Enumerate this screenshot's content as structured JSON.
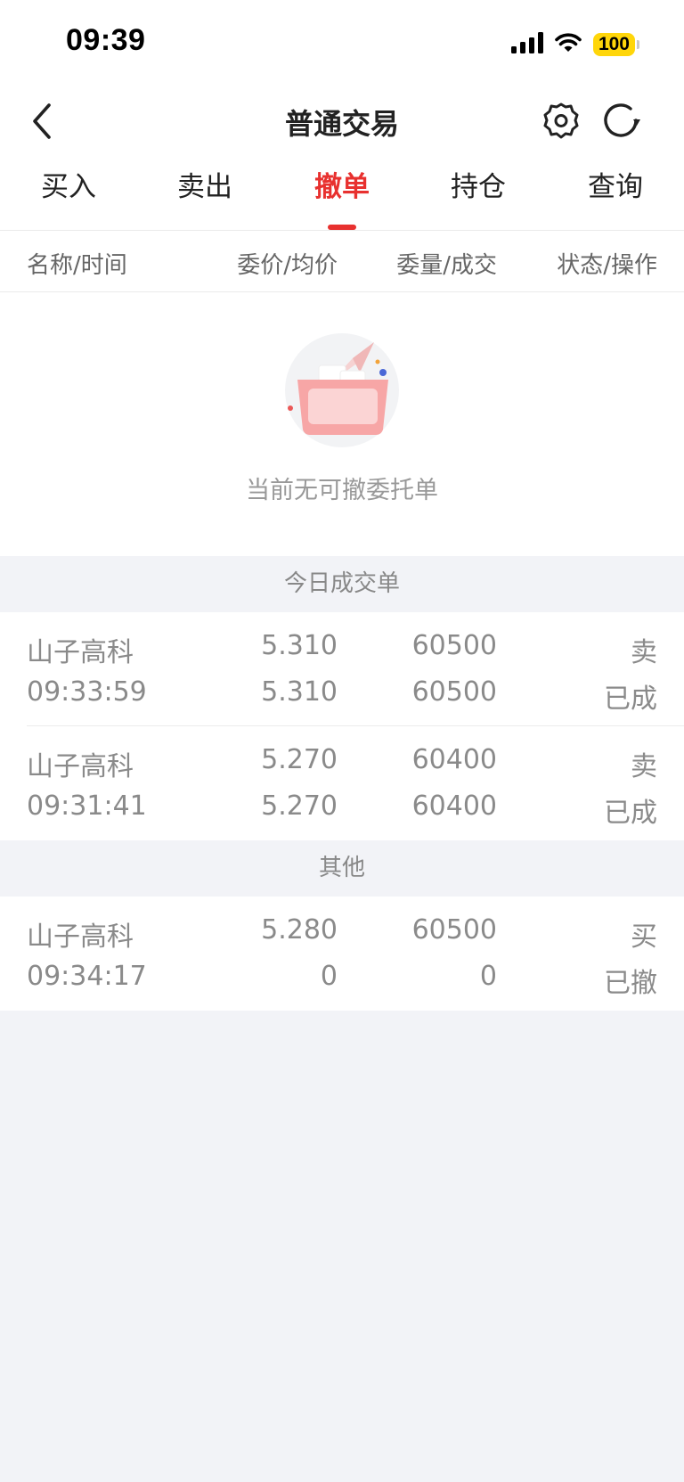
{
  "status_bar": {
    "time": "09:39",
    "battery": "100"
  },
  "nav": {
    "title": "普通交易"
  },
  "tabs": [
    {
      "label": "买入"
    },
    {
      "label": "卖出"
    },
    {
      "label": "撤单"
    },
    {
      "label": "持仓"
    },
    {
      "label": "查询"
    }
  ],
  "active_tab": "撤单",
  "columns": [
    "名称/时间",
    "委价/均价",
    "委量/成交",
    "状态/操作"
  ],
  "empty_state": {
    "message": "当前无可撤委托单"
  },
  "sections": {
    "today": {
      "title": "今日成交单",
      "rows": [
        {
          "name": "山子高科",
          "time": "09:33:59",
          "order_price": "5.310",
          "avg_price": "5.310",
          "order_qty": "60500",
          "filled_qty": "60500",
          "side": "卖",
          "status": "已成"
        },
        {
          "name": "山子高科",
          "time": "09:31:41",
          "order_price": "5.270",
          "avg_price": "5.270",
          "order_qty": "60400",
          "filled_qty": "60400",
          "side": "卖",
          "status": "已成"
        }
      ]
    },
    "other": {
      "title": "其他",
      "rows": [
        {
          "name": "山子高科",
          "time": "09:34:17",
          "order_price": "5.280",
          "avg_price": "0",
          "order_qty": "60500",
          "filled_qty": "0",
          "side": "买",
          "status": "已撤"
        }
      ]
    }
  },
  "colors": {
    "accent": "#e8312f",
    "text_primary": "#222222",
    "text_muted": "#8a8a8a",
    "page_bg": "#f2f3f7",
    "battery": "#ffd60a"
  },
  "icons": {
    "back": "chevron-left-icon",
    "settings": "gear-icon",
    "refresh": "refresh-icon",
    "signal": "cellular-signal-icon",
    "wifi": "wifi-icon",
    "empty": "empty-box-illustration"
  }
}
